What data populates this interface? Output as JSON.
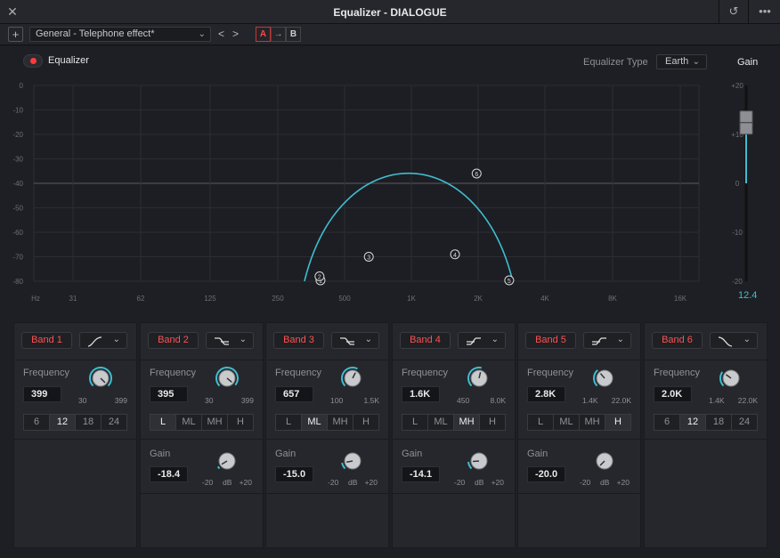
{
  "window": {
    "title": "Equalizer - DIALOGUE"
  },
  "toolbar": {
    "preset": "General - Telephone effect*",
    "prev": "<",
    "next": ">",
    "a_label": "A",
    "arrow_label": "→",
    "b_label": "B",
    "add_label": "+"
  },
  "eq": {
    "toggle_label": "Equalizer",
    "type_label": "Equalizer Type",
    "type_value": "Earth",
    "gain_label": "Gain",
    "gain_value": "12.4",
    "gain_fraction": 0.81
  },
  "graph": {
    "y_left_ticks": [
      "0",
      "-10",
      "-20",
      "-30",
      "-40",
      "-50",
      "-60",
      "-70",
      "-80"
    ],
    "y_right_ticks": [
      "+20",
      "+10",
      "0",
      "-10",
      "-20"
    ],
    "x_ticks": [
      "Hz",
      "31",
      "62",
      "125",
      "250",
      "500",
      "1K",
      "2K",
      "4K",
      "8K",
      "16K"
    ],
    "nodes": [
      {
        "n": "1",
        "label": "1",
        "freq": 399,
        "db": -80
      },
      {
        "n": "2",
        "label": "2",
        "freq": 395,
        "db": -78
      },
      {
        "n": "3",
        "label": "3",
        "freq": 657,
        "db": -70
      },
      {
        "n": "4",
        "label": "4",
        "freq": 1600,
        "db": -69
      },
      {
        "n": "5",
        "label": "5",
        "freq": 2800,
        "db": -80
      },
      {
        "n": "6",
        "label": "6",
        "freq": 2000,
        "db": -36
      }
    ],
    "curve_color": "#3fbdd0"
  },
  "bands": [
    {
      "name": "Band 1",
      "freq_label": "Frequency",
      "freq": "399",
      "range_lo": "30",
      "range_hi": "399",
      "seg": [
        "6",
        "12",
        "18",
        "24"
      ],
      "seg_on": 1,
      "has_gain": false,
      "shape": "highpass"
    },
    {
      "name": "Band 2",
      "freq_label": "Frequency",
      "freq": "395",
      "range_lo": "30",
      "range_hi": "399",
      "seg": [
        "L",
        "ML",
        "MH",
        "H"
      ],
      "seg_on": 0,
      "has_gain": true,
      "gain_label": "Gain",
      "gain": "-18.4",
      "gain_lo": "-20",
      "gain_mid": "dB",
      "gain_hi": "+20",
      "shape": "shelf"
    },
    {
      "name": "Band 3",
      "freq_label": "Frequency",
      "freq": "657",
      "range_lo": "100",
      "range_hi": "1.5K",
      "seg": [
        "L",
        "ML",
        "MH",
        "H"
      ],
      "seg_on": 1,
      "has_gain": true,
      "gain_label": "Gain",
      "gain": "-15.0",
      "gain_lo": "-20",
      "gain_mid": "dB",
      "gain_hi": "+20",
      "shape": "shelf"
    },
    {
      "name": "Band 4",
      "freq_label": "Frequency",
      "freq": "1.6K",
      "range_lo": "450",
      "range_hi": "8.0K",
      "seg": [
        "L",
        "ML",
        "MH",
        "H"
      ],
      "seg_on": 2,
      "has_gain": true,
      "gain_label": "Gain",
      "gain": "-14.1",
      "gain_lo": "-20",
      "gain_mid": "dB",
      "gain_hi": "+20",
      "shape": "shelf2"
    },
    {
      "name": "Band 5",
      "freq_label": "Frequency",
      "freq": "2.8K",
      "range_lo": "1.4K",
      "range_hi": "22.0K",
      "seg": [
        "L",
        "ML",
        "MH",
        "H"
      ],
      "seg_on": 3,
      "has_gain": true,
      "gain_label": "Gain",
      "gain": "-20.0",
      "gain_lo": "-20",
      "gain_mid": "dB",
      "gain_hi": "+20",
      "shape": "shelf2"
    },
    {
      "name": "Band 6",
      "freq_label": "Frequency",
      "freq": "2.0K",
      "range_lo": "1.4K",
      "range_hi": "22.0K",
      "seg": [
        "6",
        "12",
        "18",
        "24"
      ],
      "seg_on": 1,
      "has_gain": false,
      "shape": "lowpass"
    }
  ]
}
